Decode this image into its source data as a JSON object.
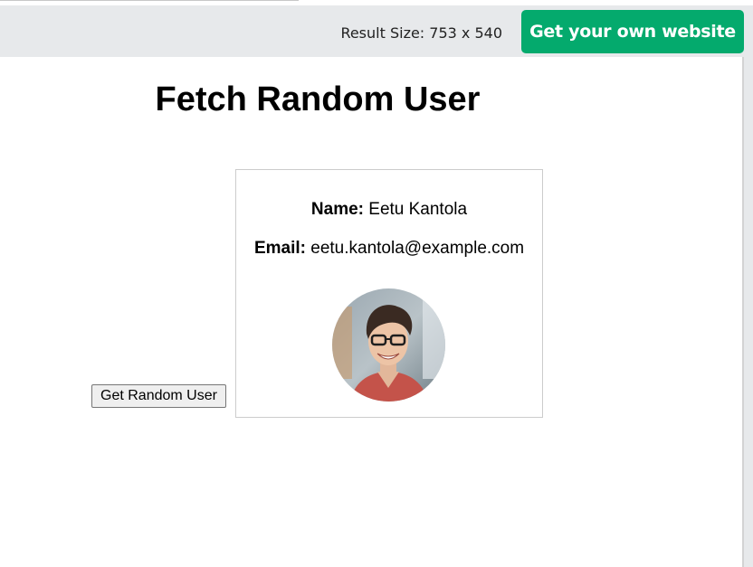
{
  "topbar": {
    "result_size": "Result Size: 753 x 540",
    "get_website_label": "Get your own website",
    "accent_color": "#04aa6d"
  },
  "page": {
    "title": "Fetch Random User",
    "button_label": "Get Random User"
  },
  "user": {
    "name_label": "Name:",
    "name": "Eetu Kantola",
    "email_label": "Email:",
    "email": "eetu.kantola@example.com",
    "avatar_icon": "user-photo-avatar"
  }
}
